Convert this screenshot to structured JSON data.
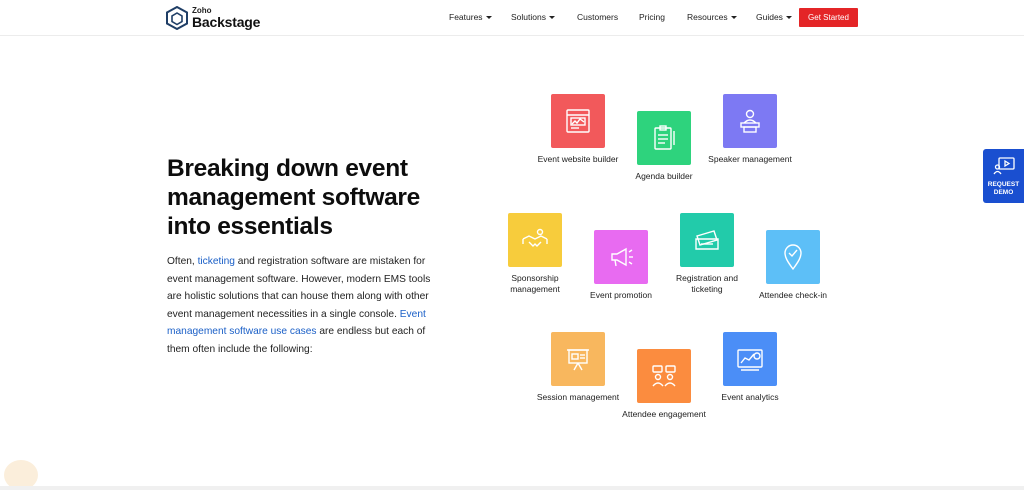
{
  "brand": {
    "small": "Zoho",
    "name": "Backstage",
    "color": "#1f3e66"
  },
  "nav": {
    "items": [
      {
        "label": "Features",
        "dropdown": true
      },
      {
        "label": "Solutions",
        "dropdown": true
      },
      {
        "label": "Customers",
        "dropdown": false
      },
      {
        "label": "Pricing",
        "dropdown": false
      },
      {
        "label": "Resources",
        "dropdown": true
      },
      {
        "label": "Guides",
        "dropdown": true
      }
    ],
    "cta": "Get Started",
    "cta_color": "#e42527"
  },
  "hero": {
    "title": "Breaking down event management software into essentials",
    "body_1": "Often, ",
    "link_1": "ticketing",
    "body_2": " and registration software are mistaken for event management software. However, modern EMS tools are holistic solutions that can house them along with other event management necessities in a single console. ",
    "link_2": "Event management software use cases",
    "body_3": " are endless but each of them often include the following:"
  },
  "features": [
    {
      "label": "Event website builder",
      "color": "#f2595b",
      "icon": "website-icon"
    },
    {
      "label": "Agenda builder",
      "color": "#2ed37d",
      "icon": "agenda-icon"
    },
    {
      "label": "Speaker management",
      "color": "#7d79f3",
      "icon": "speaker-icon"
    },
    {
      "label": "Sponsorship management",
      "color": "#f7cc3c",
      "icon": "handshake-icon"
    },
    {
      "label": "Event promotion",
      "color": "#e86bf1",
      "icon": "megaphone-icon"
    },
    {
      "label": "Registration and ticketing",
      "color": "#22cbaa",
      "icon": "ticket-icon"
    },
    {
      "label": "Attendee check-in",
      "color": "#5dbff7",
      "icon": "location-check-icon"
    },
    {
      "label": "Session management",
      "color": "#f8b75e",
      "icon": "presentation-icon"
    },
    {
      "label": "Attendee engagement",
      "color": "#fb8c3f",
      "icon": "chat-people-icon"
    },
    {
      "label": "Event analytics",
      "color": "#4b8ef7",
      "icon": "analytics-icon"
    }
  ],
  "request_demo": {
    "line1": "REQUEST",
    "line2": "DEMO",
    "color": "#1a4fd0"
  }
}
